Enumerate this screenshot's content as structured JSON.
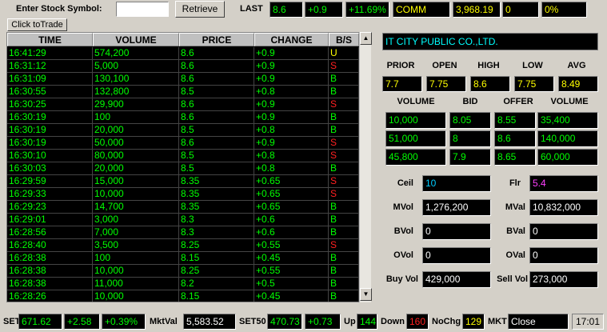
{
  "top": {
    "symbol_label": "Enter Stock Symbol:",
    "symbol_value": "",
    "retrieve_label": "Retrieve",
    "last_label": "LAST",
    "last": "8.6",
    "change": "+0.9",
    "percent": "+11.69%",
    "comm_label": "COMM",
    "comm_value": "3,968.19",
    "zero_value": "0",
    "zero_percent": "0%"
  },
  "click_to_trade": "Click toTrade",
  "grid": {
    "headers": [
      "TIME",
      "VOLUME",
      "PRICE",
      "CHANGE",
      "B/S"
    ],
    "rows": [
      {
        "time": "16:41:29",
        "volume": "574,200",
        "price": "8.6",
        "change": "+0.9",
        "bs": "U"
      },
      {
        "time": "16:31:12",
        "volume": "5,000",
        "price": "8.6",
        "change": "+0.9",
        "bs": "S"
      },
      {
        "time": "16:31:09",
        "volume": "130,100",
        "price": "8.6",
        "change": "+0.9",
        "bs": "B"
      },
      {
        "time": "16:30:55",
        "volume": "132,800",
        "price": "8.5",
        "change": "+0.8",
        "bs": "B"
      },
      {
        "time": "16:30:25",
        "volume": "29,900",
        "price": "8.6",
        "change": "+0.9",
        "bs": "S"
      },
      {
        "time": "16:30:19",
        "volume": "100",
        "price": "8.6",
        "change": "+0.9",
        "bs": "B"
      },
      {
        "time": "16:30:19",
        "volume": "20,000",
        "price": "8.5",
        "change": "+0.8",
        "bs": "B"
      },
      {
        "time": "16:30:19",
        "volume": "50,000",
        "price": "8.6",
        "change": "+0.9",
        "bs": "S"
      },
      {
        "time": "16:30:10",
        "volume": "80,000",
        "price": "8.5",
        "change": "+0.8",
        "bs": "S"
      },
      {
        "time": "16:30:03",
        "volume": "20,000",
        "price": "8.5",
        "change": "+0.8",
        "bs": "B"
      },
      {
        "time": "16:29:59",
        "volume": "15,000",
        "price": "8.35",
        "change": "+0.65",
        "bs": "S"
      },
      {
        "time": "16:29:33",
        "volume": "10,000",
        "price": "8.35",
        "change": "+0.65",
        "bs": "S"
      },
      {
        "time": "16:29:23",
        "volume": "14,700",
        "price": "8.35",
        "change": "+0.65",
        "bs": "B"
      },
      {
        "time": "16:29:01",
        "volume": "3,000",
        "price": "8.3",
        "change": "+0.6",
        "bs": "B"
      },
      {
        "time": "16:28:56",
        "volume": "7,000",
        "price": "8.3",
        "change": "+0.6",
        "bs": "B"
      },
      {
        "time": "16:28:40",
        "volume": "3,500",
        "price": "8.25",
        "change": "+0.55",
        "bs": "S"
      },
      {
        "time": "16:28:38",
        "volume": "100",
        "price": "8.15",
        "change": "+0.45",
        "bs": "B"
      },
      {
        "time": "16:28:38",
        "volume": "10,000",
        "price": "8.25",
        "change": "+0.55",
        "bs": "B"
      },
      {
        "time": "16:28:38",
        "volume": "11,000",
        "price": "8.2",
        "change": "+0.5",
        "bs": "B"
      },
      {
        "time": "16:28:26",
        "volume": "10,000",
        "price": "8.15",
        "change": "+0.45",
        "bs": "B"
      }
    ]
  },
  "company": "IT CITY PUBLIC CO.,LTD.",
  "quote": {
    "labels": [
      "PRIOR",
      "OPEN",
      "HIGH",
      "LOW",
      "AVG"
    ],
    "values": [
      "7.7",
      "7.75",
      "8.6",
      "7.75",
      "8.49"
    ]
  },
  "book": {
    "labels": [
      "VOLUME",
      "BID",
      "OFFER",
      "VOLUME"
    ],
    "rows": [
      [
        "10,000",
        "8.05",
        "8.55",
        "35,400"
      ],
      [
        "51,000",
        "8",
        "8.6",
        "140,000"
      ],
      [
        "45,800",
        "7.9",
        "8.65",
        "60,000"
      ]
    ]
  },
  "stats": {
    "ceil_label": "Ceil",
    "ceil": "10",
    "flr_label": "Flr",
    "flr": "5.4",
    "mvol_label": "MVol",
    "mvol": "1,276,200",
    "mval_label": "MVal",
    "mval": "10,832,000",
    "bvol_label": "BVol",
    "bvol": "0",
    "bval_label": "BVal",
    "bval": "0",
    "ovol_label": "OVol",
    "ovol": "0",
    "oval_label": "OVal",
    "oval": "0",
    "buyvol_label": "Buy Vol",
    "buyvol": "429,000",
    "sellvol_label": "Sell Vol",
    "sellvol": "273,000"
  },
  "bottom": {
    "set_label": "SET",
    "set": "671.62",
    "set_chg": "+2.58",
    "set_pct": "+0.39%",
    "mktval_label": "MktVal",
    "mktval": "5,583.52",
    "set50_label": "SET50",
    "set50": "470.73",
    "set50_chg": "+0.73",
    "up_label": "Up",
    "up": "144",
    "down_label": "Down",
    "down": "160",
    "nochg_label": "NoChg",
    "nochg": "129",
    "mkt_label": "MKT",
    "mkt": "Close",
    "time": "17:01"
  },
  "colors": {
    "buy": "#00ff00",
    "sell": "#ff2020",
    "unknown": "#ffff00"
  }
}
